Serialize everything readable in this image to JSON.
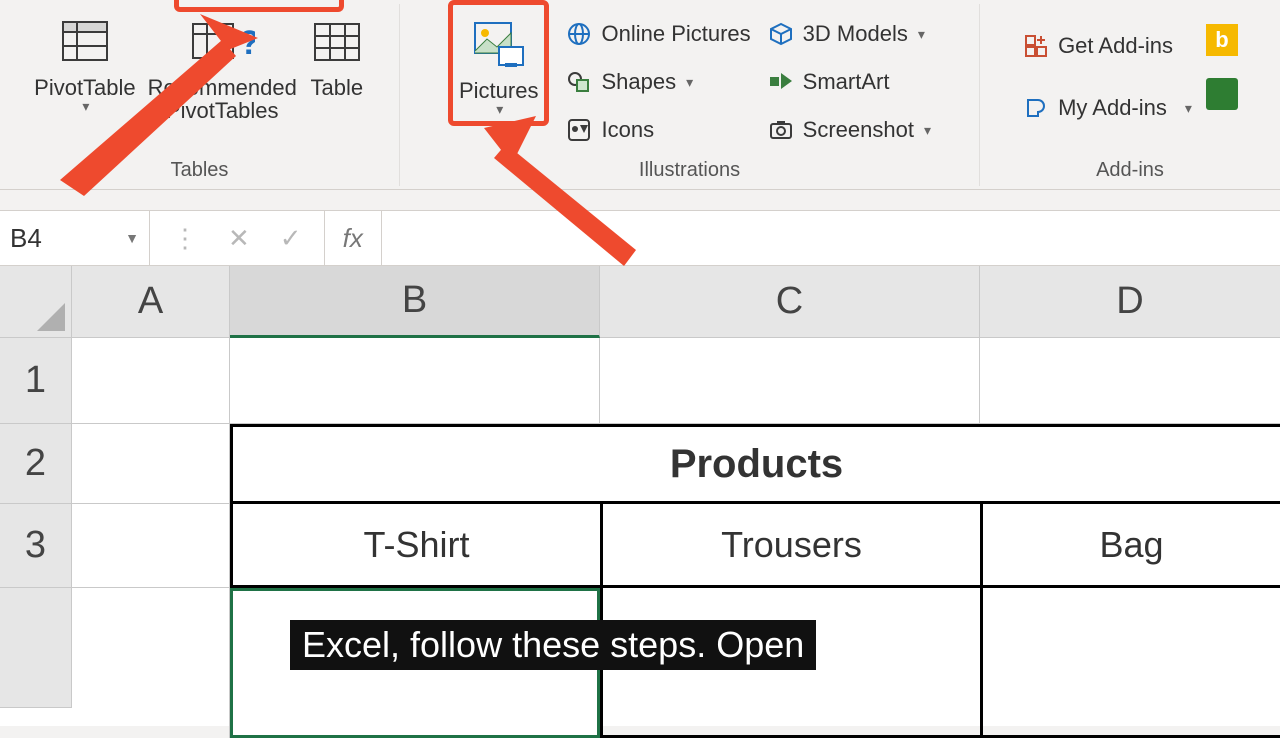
{
  "ribbon": {
    "groups": {
      "tables": {
        "label": "Tables",
        "pivot_table": "PivotTable",
        "recommended": "Recommended\nPivotTables",
        "table": "Table"
      },
      "illustrations": {
        "label": "Illustrations",
        "pictures": "Pictures",
        "online_pictures": "Online Pictures",
        "shapes": "Shapes",
        "icons": "Icons",
        "models3d": "3D Models",
        "smartart": "SmartArt",
        "screenshot": "Screenshot"
      },
      "addins": {
        "label": "Add-ins",
        "get": "Get Add-ins",
        "my": "My Add-ins"
      }
    }
  },
  "namebox": {
    "value": "B4"
  },
  "fx_label": "fx",
  "columns": {
    "A": "A",
    "B": "B",
    "C": "C",
    "D": "D"
  },
  "rows": {
    "r1": "1",
    "r2": "2",
    "r3": "3"
  },
  "sheet": {
    "products_header": "Products",
    "b3": "T-Shirt",
    "c3": "Trousers",
    "d3": "Bag"
  },
  "caption": "Excel, follow these steps. Open"
}
